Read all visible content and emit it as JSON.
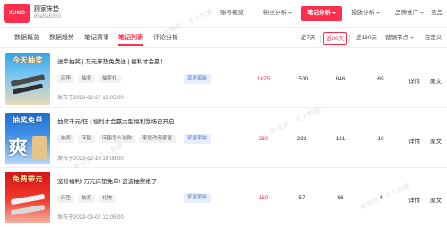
{
  "brand": {
    "logo_text": "XUNO",
    "accent": "#ff2e4d"
  },
  "account": {
    "name": "顾家床垫",
    "id": "85a5a6350"
  },
  "nav": [
    {
      "label": "账号概览",
      "has_caret": false,
      "active": false
    },
    {
      "label": "粉丝分析",
      "has_caret": true,
      "active": false
    },
    {
      "label": "笔记分析",
      "has_caret": true,
      "active": true
    },
    {
      "label": "投放分析",
      "has_caret": true,
      "active": false
    },
    {
      "label": "品牌推广",
      "has_caret": true,
      "active": false
    },
    {
      "label": "竞品分析",
      "has_caret": true,
      "active": false
    }
  ],
  "tabs": [
    {
      "label": "数据概览",
      "active": false
    },
    {
      "label": "数据趋势",
      "active": false
    },
    {
      "label": "笔记赛事",
      "active": false
    },
    {
      "label": "笔记列表",
      "active": true
    },
    {
      "label": "评论分析",
      "active": false
    }
  ],
  "periods": [
    {
      "label": "近7天",
      "active": false
    },
    {
      "label": "近30天",
      "active": true
    },
    {
      "label": "近180天",
      "active": false
    },
    {
      "label": "营销节点",
      "active": false,
      "has_caret": true
    },
    {
      "label": "自定义",
      "active": false,
      "has_caret": true
    }
  ],
  "posts": [
    {
      "thumb_caption": "今天抽奖",
      "title": "送幸抽奖 | 万元床垫免费送 | 福利才会赢！",
      "tags": [
        "床垫",
        "抽奖",
        "抽奖礼"
      ],
      "date": "发布于2023-02-27 15:05:00",
      "type": "家居家装",
      "metrics": [
        "1675",
        "1530",
        "846",
        "69"
      ],
      "actions": [
        "详情",
        "原文"
      ]
    },
    {
      "thumb_caption": "抽奖免单",
      "title": "抽奖千元!狂 | 福利才会赢大型福利我场已开启",
      "tags": [
        "抽奖",
        "床垫",
        "床垫怎么选购",
        "家居改造家居"
      ],
      "date": "发布于2023-02-16 10:08:00",
      "type": "家居家装",
      "metrics": [
        "280",
        "232",
        "121",
        "10"
      ],
      "actions": [
        "详情",
        "原文"
      ]
    },
    {
      "thumb_caption": "免费带走",
      "title": "宠粉福利! 万元床垫免单! 这波抽奖绝了",
      "tags": [
        "床垫",
        "抽奖",
        "礼物"
      ],
      "date": "发布于2023-03-02 12:05:00",
      "type": "家居家装",
      "metrics": [
        "160",
        "57",
        "66",
        "4"
      ],
      "actions": [
        "详情",
        "原文"
      ]
    }
  ],
  "watermark": "新视界 · 达人数据"
}
